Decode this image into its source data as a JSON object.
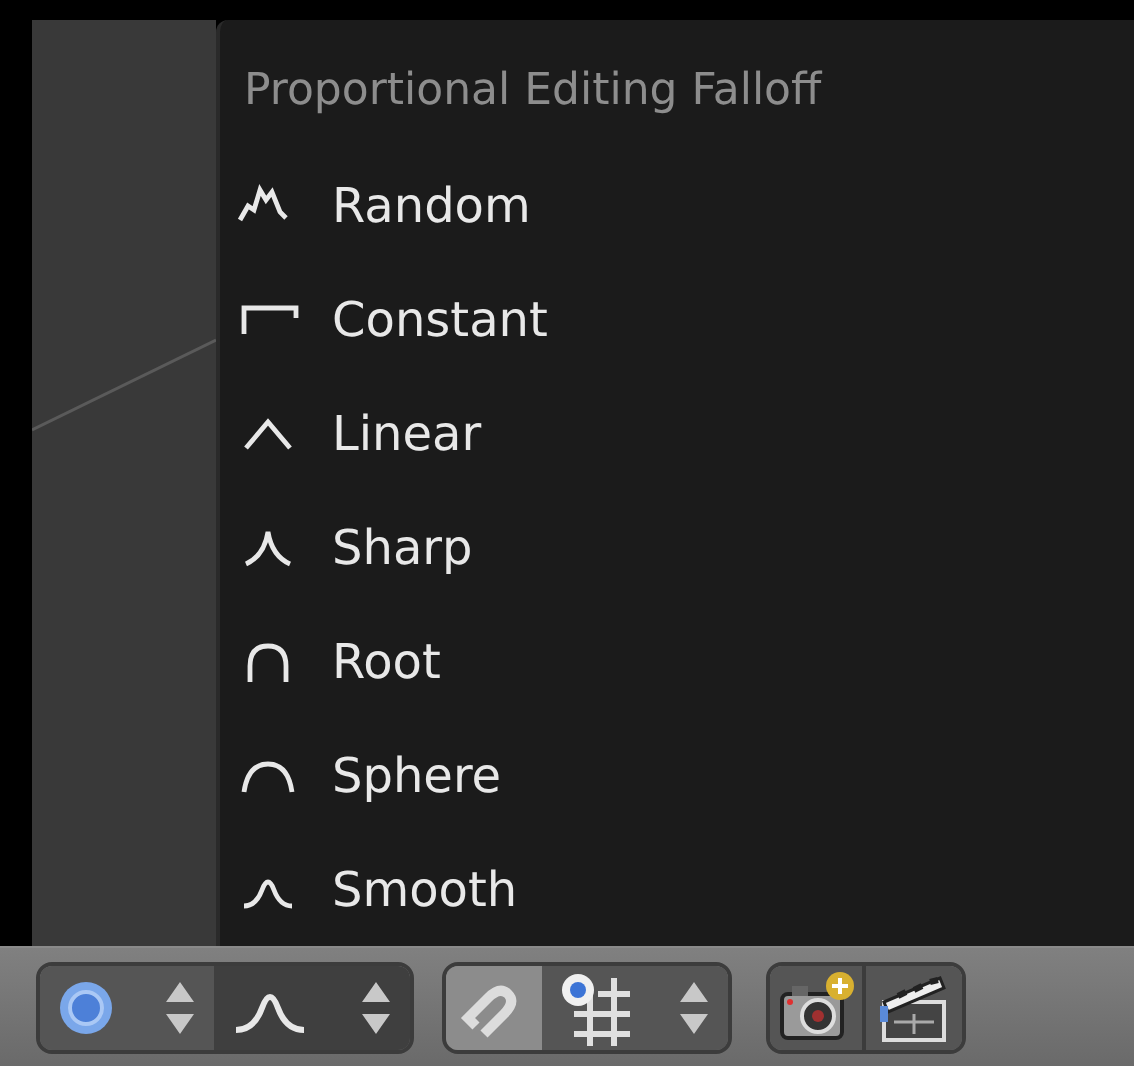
{
  "menu": {
    "title": "Proportional Editing Falloff",
    "items": [
      {
        "kind": "random",
        "label": "Random"
      },
      {
        "kind": "constant",
        "label": "Constant"
      },
      {
        "kind": "linear",
        "label": "Linear"
      },
      {
        "kind": "sharp",
        "label": "Sharp"
      },
      {
        "kind": "root",
        "label": "Root"
      },
      {
        "kind": "sphere",
        "label": "Sphere"
      },
      {
        "kind": "smooth",
        "label": "Smooth"
      }
    ]
  }
}
